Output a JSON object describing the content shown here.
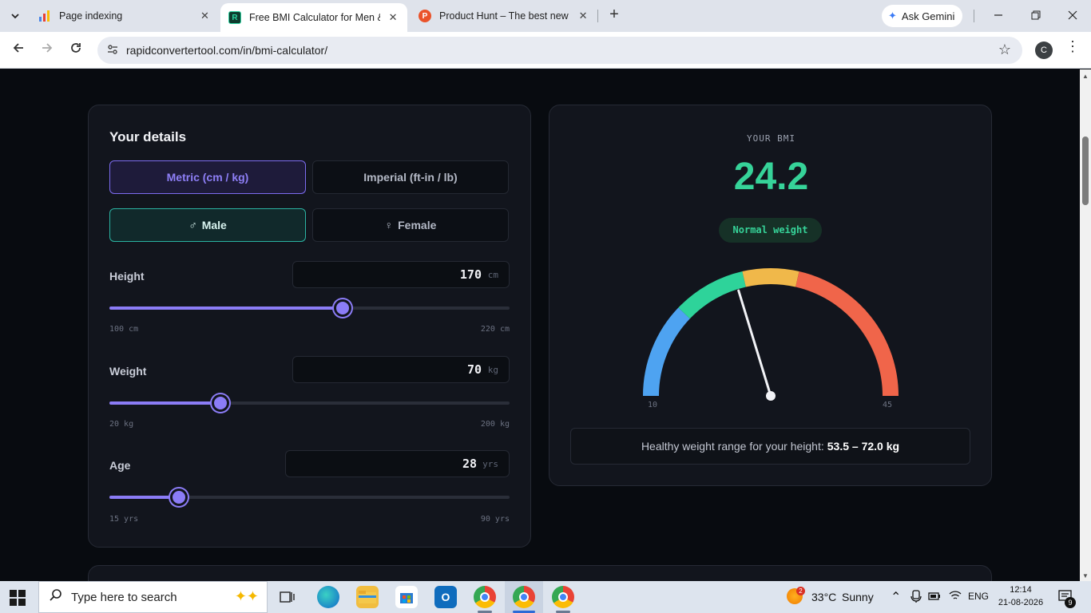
{
  "browser": {
    "tabs": [
      {
        "title": "Page indexing",
        "close": "✕",
        "favicon_color": "#4a86e8",
        "icon": "search-console-icon"
      },
      {
        "title": "Free BMI Calculator for Men & ’",
        "close": "✕",
        "favicon_color": "#0f3b2e",
        "favicon_text": "R",
        "icon": "rapidconverter-icon"
      },
      {
        "title": "Product Hunt – The best new p",
        "close": "✕",
        "favicon_color": "#ea532a",
        "favicon_text": "P",
        "icon": "producthunt-icon"
      }
    ],
    "new_tab": "+",
    "ask_gemini": "Ask Gemini",
    "url": "rapidconvertertool.com/in/bmi-calculator/",
    "profile_initial": "C"
  },
  "details": {
    "title": "Your details",
    "units": {
      "metric": "Metric (cm / kg)",
      "imperial": "Imperial (ft-in / lb)",
      "selected": "metric"
    },
    "gender": {
      "male": "Male",
      "female": "Female",
      "male_icon": "♂",
      "female_icon": "♀",
      "selected": "male"
    },
    "height": {
      "label": "Height",
      "value": "170",
      "unit": "cm",
      "min_label": "100 cm",
      "max_label": "220 cm",
      "min": 100,
      "max": 220,
      "current": 170
    },
    "weight": {
      "label": "Weight",
      "value": "70",
      "unit": "kg",
      "min_label": "20 kg",
      "max_label": "200 kg",
      "min": 20,
      "max": 200,
      "current": 70
    },
    "age": {
      "label": "Age",
      "value": "28",
      "unit": "yrs",
      "min_label": "15 yrs",
      "max_label": "90 yrs",
      "min": 15,
      "max": 90,
      "current": 28
    }
  },
  "result": {
    "caption": "YOUR BMI",
    "bmi": "24.2",
    "category": "Normal weight",
    "gauge": {
      "min": 10,
      "max": 45,
      "min_label": "10",
      "max_label": "45",
      "value": 24.2,
      "bands": [
        {
          "from": 10,
          "to": 18.5,
          "color": "#4ea3f1"
        },
        {
          "from": 18.5,
          "to": 25,
          "color": "#2ed39a"
        },
        {
          "from": 25,
          "to": 30,
          "color": "#f0b84a"
        },
        {
          "from": 30,
          "to": 45,
          "color": "#f0654a"
        }
      ]
    },
    "healthy_label": "Healthy weight range for your height:",
    "healthy_range": "53.5 – 72.0 kg"
  },
  "taskbar": {
    "search_placeholder": "Type here to search",
    "weather_temp": "33°C",
    "weather_desc": "Sunny",
    "weather_badge": "2",
    "lang": "ENG",
    "time": "12:14",
    "date": "21-08-2026",
    "notifications": "9"
  },
  "colors": {
    "accent": "#8b7cf6",
    "teal": "#2bb3a2",
    "bmi_green": "#36d399"
  }
}
